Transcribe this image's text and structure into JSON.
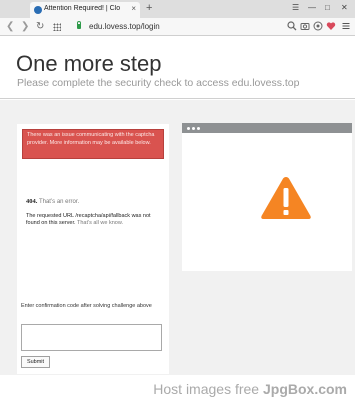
{
  "browser": {
    "tab_title": "Attention Required! | Clo",
    "tab_close": "×",
    "new_tab": "+",
    "window_buttons": [
      "☰",
      "—",
      "□",
      "✕"
    ],
    "url": "edu.lovess.top/login",
    "toolbar_icons": [
      "search-icon",
      "camera-icon",
      "shield-icon",
      "heart-icon",
      "menu-icon"
    ],
    "heart_color": "#d94a5c"
  },
  "page": {
    "title": "One more step",
    "subtitle": "Please complete the security check to access edu.lovess.top"
  },
  "captcha": {
    "error_banner": "There was an issue communicating with the captcha provider. More information may be available below.",
    "error_code": "404.",
    "error_code_suffix": "That’s an error.",
    "error_message": "The requested URL /recaptcha/api/fallback was not found on this server.",
    "error_message_suffix": "That’s all we know.",
    "confirmation_label": "Enter confirmation code after solving challenge above",
    "confirmation_value": "",
    "submit_label": "Submit"
  },
  "illustration": {
    "warning_color": "#f58523"
  },
  "watermark": {
    "prefix": "Host images free ",
    "brand": "JpgBox.com"
  }
}
